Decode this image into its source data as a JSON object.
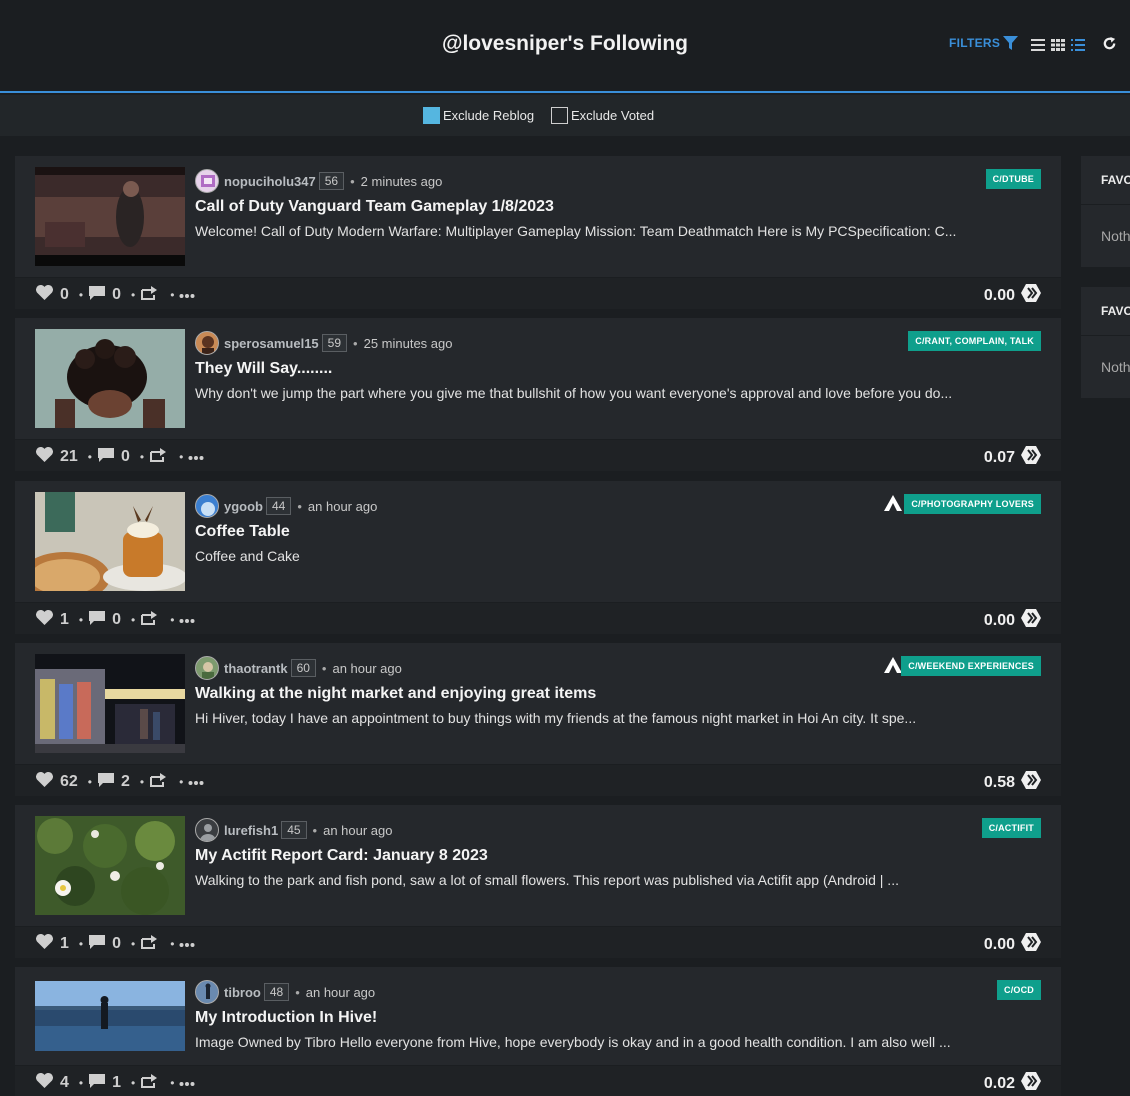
{
  "header": {
    "title": "@lovesniper's Following",
    "filters_label": "FILTERS"
  },
  "filterbar": {
    "exclude_reblog": {
      "label": "Exclude Reblog",
      "checked": true
    },
    "exclude_voted": {
      "label": "Exclude Voted",
      "checked": false
    }
  },
  "posts": [
    {
      "author": "nopuciholu347",
      "rep": "56",
      "time": "2 minutes ago",
      "community": "C/DTUBE",
      "has_app_logo": false,
      "title": "Call of Duty Vanguard Team Gameplay 1/8/2023",
      "body": "Welcome! Call of Duty Modern Warfare: Multiplayer Gameplay Mission: Team Deathmatch Here is My PCSpecification: C...",
      "votes": "0",
      "comments": "0",
      "payout": "0.00"
    },
    {
      "author": "sperosamuel15",
      "rep": "59",
      "time": "25 minutes ago",
      "community": "C/RANT, COMPLAIN, TALK",
      "has_app_logo": false,
      "title": "They Will Say........",
      "body": "Why don't we jump the part where you give me that bullshit of how you want everyone's approval and love before you do...",
      "votes": "21",
      "comments": "0",
      "payout": "0.07"
    },
    {
      "author": "ygoob",
      "rep": "44",
      "time": "an hour ago",
      "community": "C/PHOTOGRAPHY LOVERS",
      "has_app_logo": true,
      "title": "Coffee Table",
      "body": "Coffee and Cake",
      "votes": "1",
      "comments": "0",
      "payout": "0.00"
    },
    {
      "author": "thaotrantk",
      "rep": "60",
      "time": "an hour ago",
      "community": "C/WEEKEND EXPERIENCES",
      "has_app_logo": true,
      "title": "Walking at the night market and enjoying great items",
      "body": "Hi Hiver, today I have an appointment to buy things with my friends at the famous night market in Hoi An city. It spe...",
      "votes": "62",
      "comments": "2",
      "payout": "0.58"
    },
    {
      "author": "lurefish1",
      "rep": "45",
      "time": "an hour ago",
      "community": "C/ACTIFIT",
      "has_app_logo": false,
      "title": "My Actifit Report Card: January 8 2023",
      "body": "Walking to the park and fish pond, saw a lot of small flowers. This report was published via Actifit app (Android | ...",
      "votes": "1",
      "comments": "0",
      "payout": "0.00"
    },
    {
      "author": "tibroo",
      "rep": "48",
      "time": "an hour ago",
      "community": "C/OCD",
      "has_app_logo": false,
      "title": "My Introduction In Hive!",
      "body": "Image Owned by Tibro Hello everyone from Hive, hope everybody is okay and in a good health condition. I am also well ...",
      "votes": "4",
      "comments": "1",
      "payout": "0.02"
    }
  ],
  "sidebar": [
    {
      "title": "FAVO",
      "body": "Noth"
    },
    {
      "title": "FAVO",
      "body": "Noth"
    }
  ],
  "colors": {
    "accent": "#3a8fd9",
    "community_badge": "#0f9f8c",
    "card_bg": "#25282c",
    "page_bg": "#1b1e21"
  }
}
